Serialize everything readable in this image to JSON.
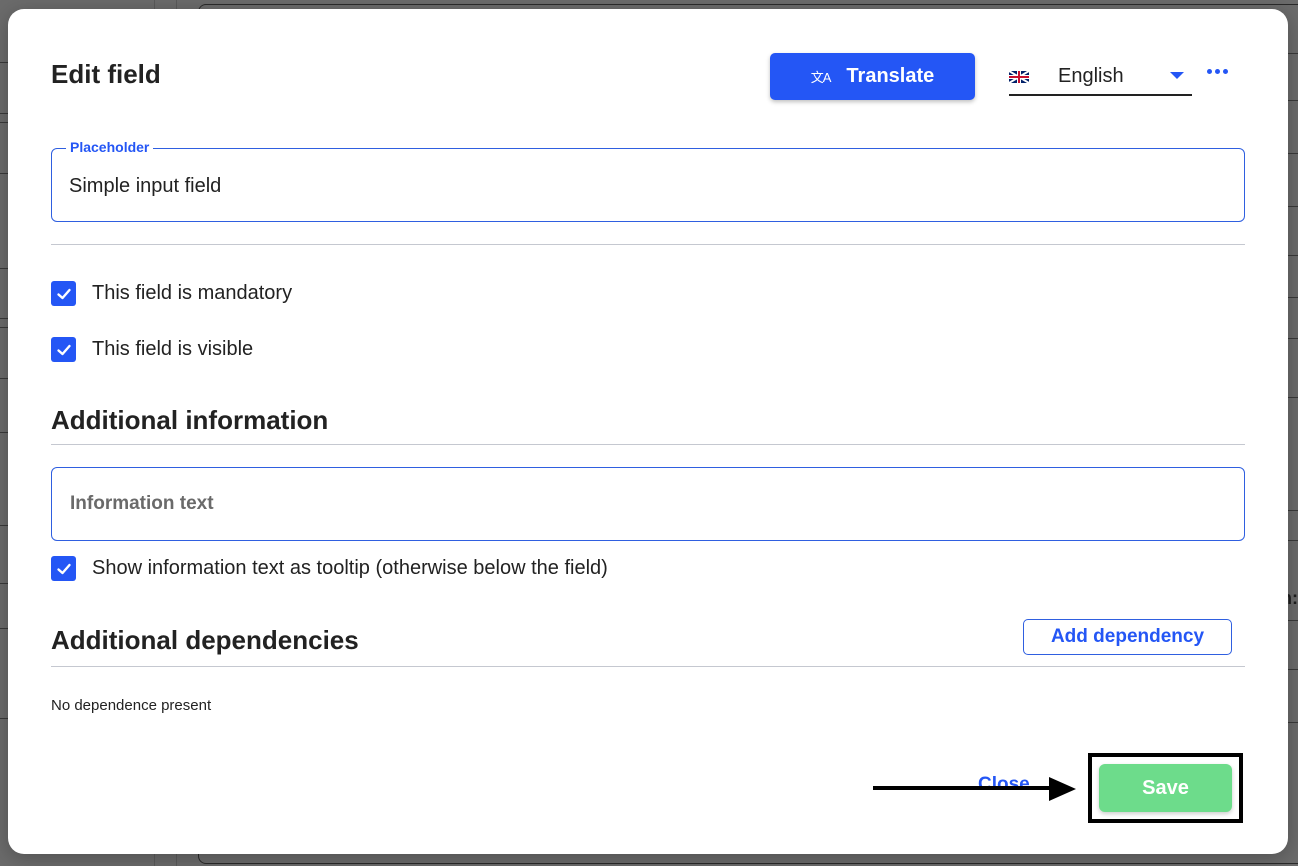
{
  "background": {
    "partial_text": "n:"
  },
  "modal": {
    "title": "Edit field",
    "header": {
      "translate_label": "Translate",
      "translate_icon": "translate-icon",
      "language": {
        "selected": "English",
        "flag_icon": "uk-flag-icon"
      },
      "more_icon": "more-horizontal-icon"
    },
    "placeholder_field": {
      "label": "Placeholder",
      "value": "Simple input field"
    },
    "checkboxes": [
      {
        "label": "This field is mandatory",
        "checked": true
      },
      {
        "label": "This field is visible",
        "checked": true
      }
    ],
    "additional_information": {
      "title": "Additional information",
      "info_text_placeholder": "Information text",
      "info_text_value": "",
      "tooltip_checkbox": {
        "label": "Show information text as tooltip (otherwise below the field)",
        "checked": true
      }
    },
    "additional_dependencies": {
      "title": "Additional dependencies",
      "add_button_label": "Add dependency",
      "empty_text": "No dependence present"
    },
    "footer": {
      "close_label": "Close",
      "save_label": "Save"
    }
  },
  "colors": {
    "primary": "#2456f5",
    "save": "#6ddc8b",
    "overlay": "#6b6b6b"
  }
}
